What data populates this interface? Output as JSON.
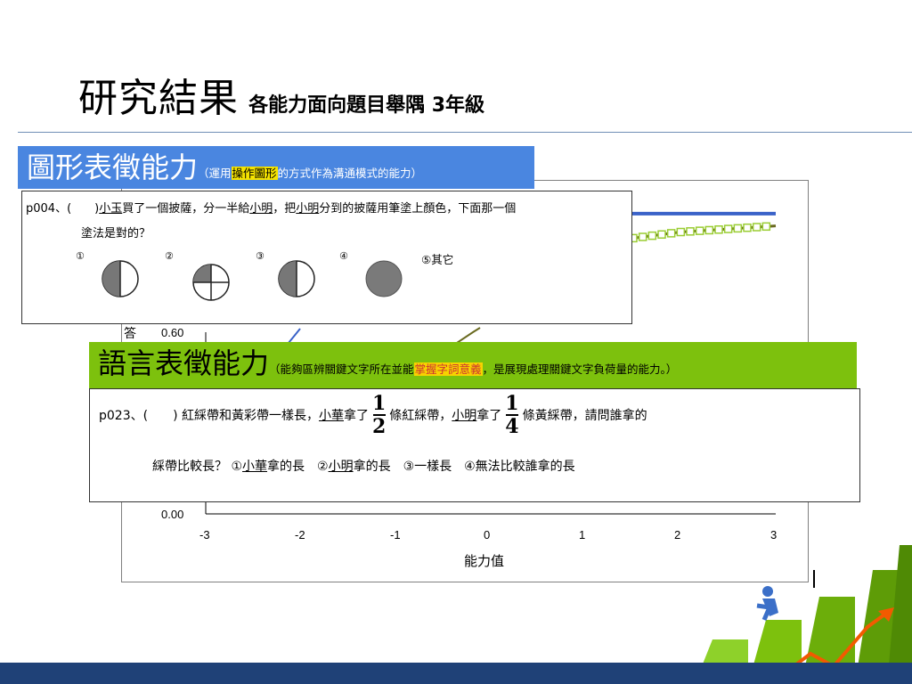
{
  "header": {
    "title": "研究結果",
    "subtitle": "各能力面向題目舉隅 3年級"
  },
  "chart_data": {
    "type": "line",
    "xlabel": "能力值",
    "ylabel": "答",
    "x_ticks": [
      "-3",
      "-2",
      "-1",
      "0",
      "1",
      "2",
      "3"
    ],
    "y_ticks_visible": [
      "0.60",
      "0.00"
    ],
    "xlim": [
      -3,
      3
    ],
    "ylim": [
      0,
      1
    ],
    "series": [
      {
        "x": [
          0.5,
          1.0,
          1.5,
          2.0,
          2.5,
          3.0
        ],
        "y": [
          0.98,
          0.98,
          0.98,
          0.98,
          0.98,
          0.98
        ],
        "color": "#3a62c8",
        "marker": "none"
      },
      {
        "x": [
          0.5,
          1.0,
          1.5,
          2.0,
          2.5,
          3.0
        ],
        "y": [
          0.86,
          0.88,
          0.9,
          0.92,
          0.93,
          0.94
        ],
        "color": "#6a6a20",
        "marker": "square"
      }
    ]
  },
  "graphic": {
    "heading": "圖形表徵能力",
    "desc_pre": "（運用",
    "desc_hl": "操作圖形",
    "desc_post": "的方式作為溝通模式的能力）",
    "question_line1_a": "p004、(　　)",
    "question_line1_b": "小玉",
    "question_line1_c": "買了一個披薩，分一半給",
    "question_line1_d": "小明",
    "question_line1_e": "，把",
    "question_line1_f": "小明",
    "question_line1_g": "分到的披薩用筆塗上顏色，下面那一個",
    "question_line2": "塗法是對的？",
    "options": [
      "①",
      "②",
      "③",
      "④",
      "⑤其它"
    ]
  },
  "language": {
    "heading": "語言表徵能力",
    "desc_pre": "（能夠區辨關鍵文字所在並能",
    "desc_hl": "掌握字詞意義",
    "desc_post": "，是展現處理關鍵文字負荷量的能力。）",
    "q_a": "p023、(　　) 紅綵帶和黃彩帶一樣長，",
    "q_b": "小華",
    "q_c": "拿了",
    "frac1_num": "1",
    "frac1_den": "2",
    "q_d": "條紅綵帶，",
    "q_e": "小明",
    "q_f": "拿了",
    "frac2_num": "1",
    "frac2_den": "4",
    "q_g": "條黃綵帶，請問誰拿的",
    "line2_a": "綵帶比較長？ ①",
    "line2_b": "小華",
    "line2_c": "拿的長　②",
    "line2_d": "小明",
    "line2_e": "拿的長　③一樣長　④無法比較誰拿的長"
  },
  "colors": {
    "blue_banner": "#4a86e0",
    "green_banner": "#7dc10d",
    "footer": "#1f4177"
  }
}
